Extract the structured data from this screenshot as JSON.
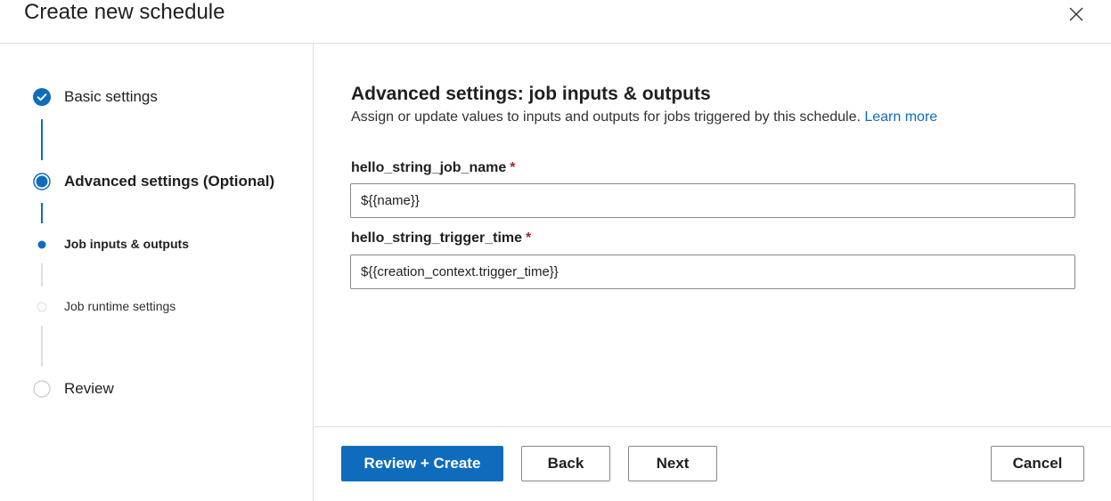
{
  "header": {
    "title": "Create new schedule",
    "close_icon": "close-icon"
  },
  "sidebar": {
    "steps": [
      {
        "label": "Basic settings",
        "state": "completed"
      },
      {
        "label": "Advanced settings (Optional)",
        "state": "current"
      },
      {
        "label": "Job inputs & outputs",
        "state": "current-substep"
      },
      {
        "label": "Job runtime settings",
        "state": "pending-substep"
      },
      {
        "label": "Review",
        "state": "pending"
      }
    ]
  },
  "main": {
    "title": "Advanced settings: job inputs & outputs",
    "description": "Assign or update values to inputs and outputs for jobs triggered by this schedule.",
    "learn_more": "Learn more",
    "fields": [
      {
        "label": "hello_string_job_name",
        "required_mark": "*",
        "value": "${{name}}"
      },
      {
        "label": "hello_string_trigger_time",
        "required_mark": "*",
        "value": "${{creation_context.trigger_time}}"
      }
    ]
  },
  "footer": {
    "review_create": "Review + Create",
    "back": "Back",
    "next": "Next",
    "cancel": "Cancel"
  },
  "colors": {
    "accent": "#0f6cbd",
    "required": "#a4262c",
    "border": "#8a8886",
    "divider": "#e1dfdd"
  }
}
